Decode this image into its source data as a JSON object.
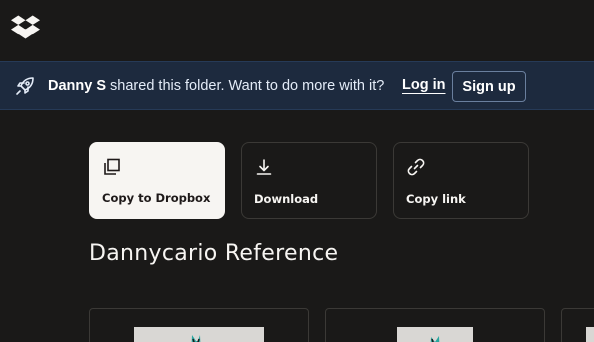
{
  "banner": {
    "sharer": "Danny S",
    "message": "shared this folder. Want to do more with it?",
    "login_label": "Log in",
    "signup_label": "Sign up"
  },
  "actions": [
    {
      "label": "Copy to Dropbox",
      "icon": "copy-icon"
    },
    {
      "label": "Download",
      "icon": "download-icon"
    },
    {
      "label": "Copy link",
      "icon": "link-icon"
    }
  ],
  "folder": {
    "title": "Dannycario Reference"
  },
  "colors": {
    "background": "#1a1918",
    "banner": "#1d2a3e",
    "accent_light": "#f7f5f2",
    "character_teal": "#2aa7a0"
  }
}
